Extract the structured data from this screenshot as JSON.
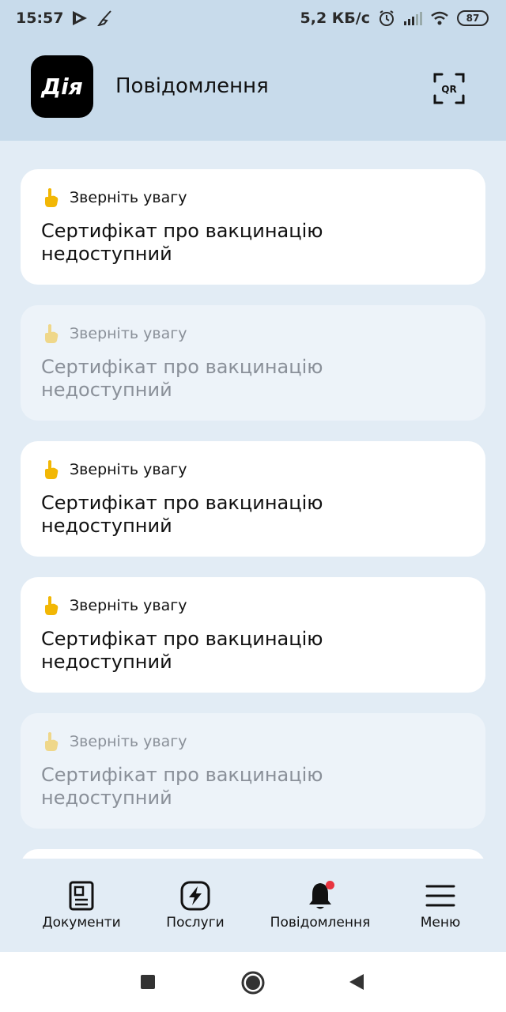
{
  "status_bar": {
    "time": "15:57",
    "network_speed": "5,2 КБ/с",
    "battery": "87",
    "icons": [
      "play-icon",
      "broom-icon",
      "alarm-icon",
      "signal-icon",
      "wifi-icon",
      "battery-icon"
    ]
  },
  "header": {
    "logo_text": "Дія",
    "title": "Повідомлення",
    "qr_label": "QR"
  },
  "notifications": [
    {
      "label": "Зверніть увагу",
      "text": "Сертифікат про вакцинацію недоступний",
      "read": false,
      "icon": "pointing-hand-icon"
    },
    {
      "label": "Зверніть увагу",
      "text": "Сертифікат про вакцинацію недоступний",
      "read": true,
      "icon": "pointing-hand-icon"
    },
    {
      "label": "Зверніть увагу",
      "text": "Сертифікат про вакцинацію недоступний",
      "read": false,
      "icon": "pointing-hand-icon"
    },
    {
      "label": "Зверніть увагу",
      "text": "Сертифікат про вакцинацію недоступний",
      "read": false,
      "icon": "pointing-hand-icon"
    },
    {
      "label": "Зверніть увагу",
      "text": "Сертифікат про вакцинацію недоступний",
      "read": true,
      "icon": "pointing-hand-icon"
    }
  ],
  "bottom_nav": {
    "items": [
      {
        "label": "Документи",
        "icon": "document-icon"
      },
      {
        "label": "Послуги",
        "icon": "lightning-icon"
      },
      {
        "label": "Повідомлення",
        "icon": "bell-icon",
        "has_badge": true
      },
      {
        "label": "Меню",
        "icon": "menu-icon"
      }
    ]
  },
  "colors": {
    "header_bg": "#c8dbeb",
    "page_bg": "#e2ecf5",
    "card_unread": "#ffffff",
    "card_read": "#edf3f9",
    "badge": "#e8343f",
    "hand": "#f2b705"
  }
}
